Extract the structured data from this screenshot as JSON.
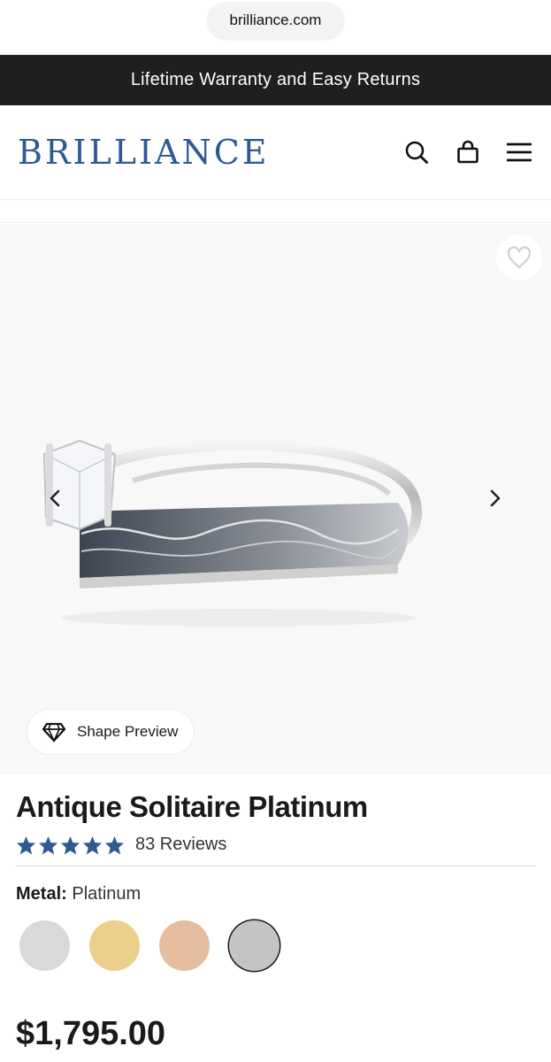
{
  "browser": {
    "url": "brilliance.com"
  },
  "promo": {
    "text": "Lifetime Warranty and Easy Returns"
  },
  "header": {
    "logo": "BRILLIANCE",
    "icons": [
      "search-icon",
      "shopping-bag-icon",
      "menu-icon"
    ]
  },
  "gallery": {
    "shape_preview_label": "Shape Preview",
    "icons": [
      "heart-icon",
      "chevron-left-icon",
      "chevron-right-icon",
      "diamond-icon"
    ]
  },
  "product": {
    "title": "Antique Solitaire Platinum",
    "rating_stars": 5,
    "reviews_label": "83 Reviews",
    "metal_label": "Metal:",
    "metal_value": "Platinum",
    "swatches": [
      {
        "name": "white-gold",
        "color": "#d9d9d9",
        "selected": false
      },
      {
        "name": "yellow-gold",
        "color": "#ecd08a",
        "selected": false
      },
      {
        "name": "rose-gold",
        "color": "#e6be9f",
        "selected": false
      },
      {
        "name": "platinum",
        "color": "#c4c4c4",
        "selected": true
      }
    ],
    "price": "$1,795.00"
  },
  "colors": {
    "brand": "#2d5a93",
    "promo_bg": "#1f1f1f",
    "star": "#2d5a93"
  }
}
